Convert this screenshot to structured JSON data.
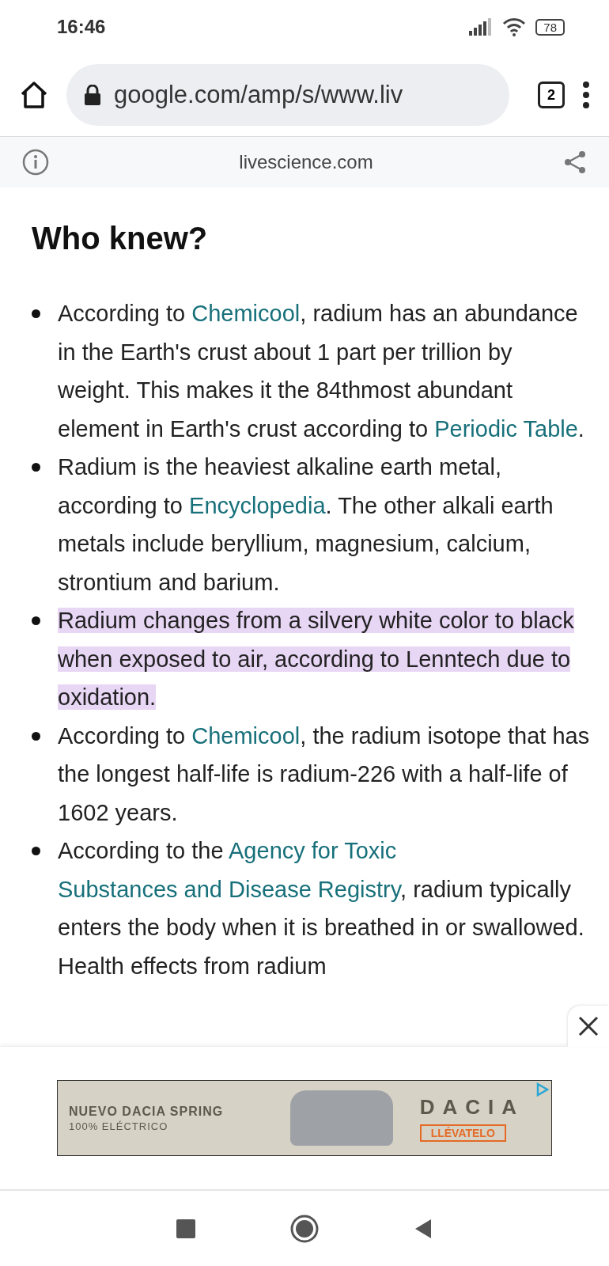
{
  "status_bar": {
    "time": "16:46",
    "battery": "78"
  },
  "toolbar": {
    "url": "google.com/amp/s/www.liv",
    "tab_count": "2"
  },
  "site_bar": {
    "domain": "livescience.com"
  },
  "article": {
    "heading": "Who knew?",
    "bullets": [
      [
        {
          "kind": "text",
          "text": "According to "
        },
        {
          "kind": "link",
          "text": "Chemicool"
        },
        {
          "kind": "text",
          "text": ", radium has an abundance in the Earth's crust about 1 part per trillion by weight. This makes it the 84thmost abundant element in Earth's crust according to "
        },
        {
          "kind": "link",
          "text": "Periodic Table"
        },
        {
          "kind": "text",
          "text": "."
        }
      ],
      [
        {
          "kind": "text",
          "text": "Radium is the heaviest alkaline earth metal, according to "
        },
        {
          "kind": "link",
          "text": "Encyclopedia"
        },
        {
          "kind": "text",
          "text": ". The other alkali earth metals include beryllium, magnesium, calcium, strontium and barium."
        }
      ],
      [
        {
          "kind": "highlight",
          "text": "Radium changes from a silvery white color to black when exposed to air, according to Lenntech due to oxidation."
        }
      ],
      [
        {
          "kind": "text",
          "text": "According to "
        },
        {
          "kind": "link",
          "text": "Chemicool"
        },
        {
          "kind": "text",
          "text": ", the radium isotope that has the longest half-life is radium-226 with a half-life of 1602 years."
        }
      ],
      [
        {
          "kind": "text",
          "text": "According to the "
        },
        {
          "kind": "link",
          "text": "Agency for Toxic"
        },
        {
          "kind": "link",
          "text": "Substances and Disease Registry"
        },
        {
          "kind": "text",
          "text": ", radium typically enters the body when it is breathed in or swallowed. Health effects from radium"
        }
      ]
    ]
  },
  "ad": {
    "headline": "NUEVO DACIA SPRING",
    "subline": "100% ELÉCTRICO",
    "brand": "DACIA",
    "cta": "LLÉVATELO"
  }
}
